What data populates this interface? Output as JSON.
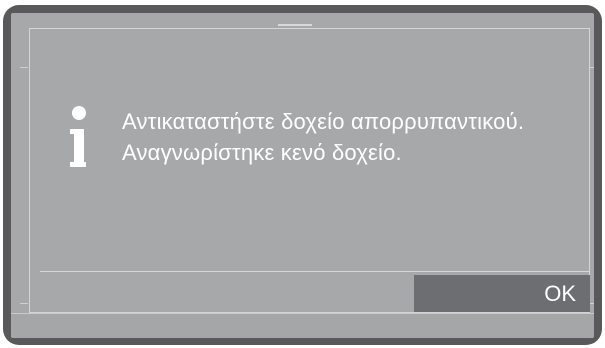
{
  "dialog": {
    "message": "Αντικαταστήστε δοχείο απορρυπαντικού. Αναγνωρίστηκε κενό δοχείο.",
    "icon": "info-icon",
    "ok_label": "OK"
  },
  "colors": {
    "frame": "#59595b",
    "screen": "#a7a8aa",
    "button": "#6d6e71",
    "text": "#ffffff"
  }
}
